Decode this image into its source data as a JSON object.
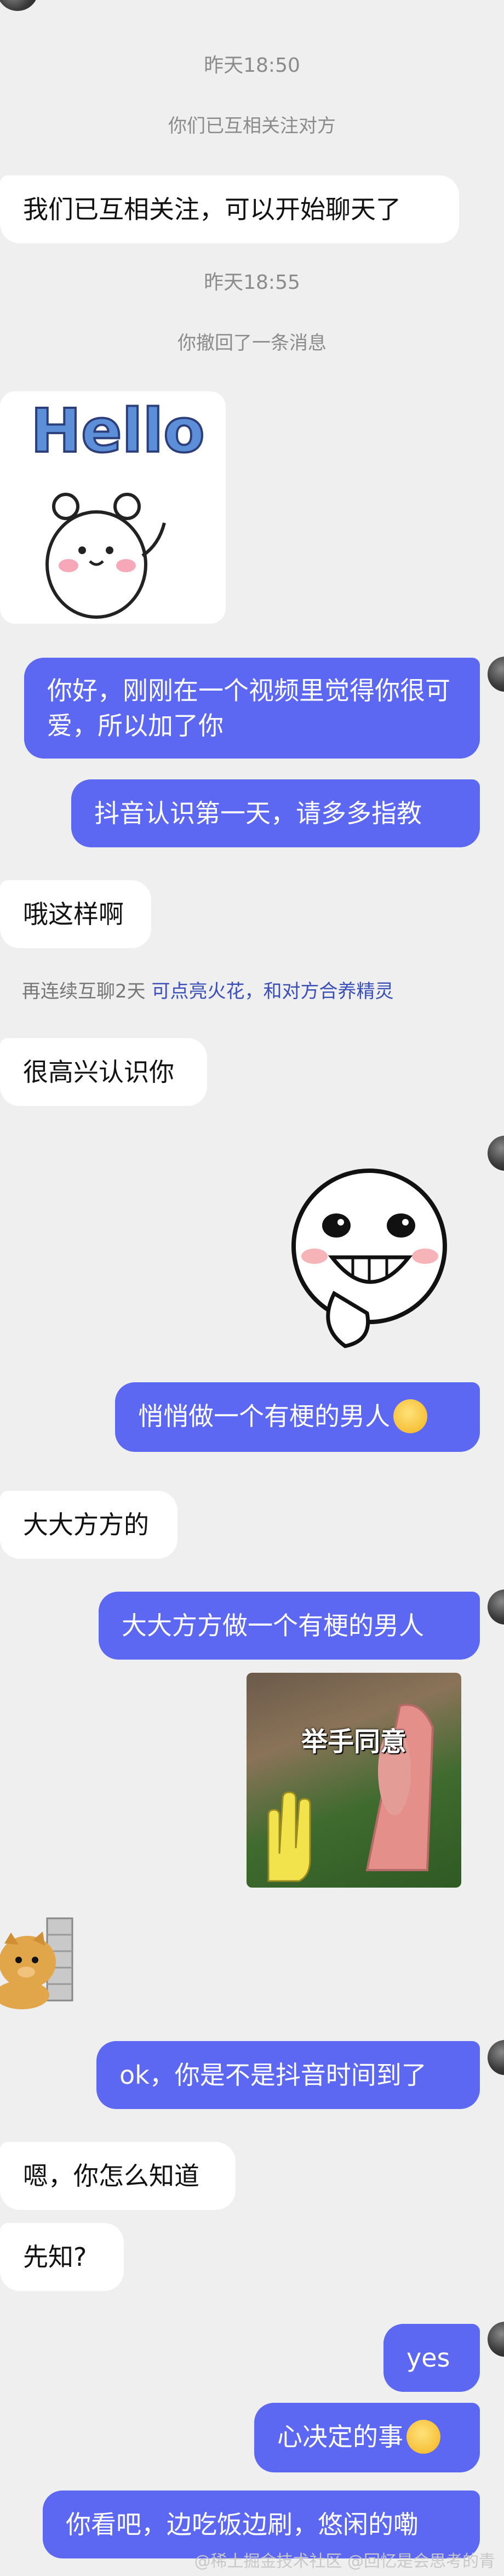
{
  "timestamps": [
    "昨天18:50",
    "昨天18:55"
  ],
  "system": {
    "followed": "你们已互相关注对方",
    "recalled": "你撤回了一条消息"
  },
  "messages": [
    {
      "side": "left",
      "text": "我们已互相关注，可以开始聊天了"
    },
    {
      "side": "right",
      "text": "你好，刚刚在一个视频里觉得你很可爱，所以加了你"
    },
    {
      "side": "right",
      "text": "抖音认识第一天，请多多指教"
    },
    {
      "side": "left",
      "text": "哦这样啊"
    },
    {
      "side": "left",
      "text": "很高兴认识你"
    },
    {
      "side": "right",
      "text": "悄悄做一个有梗的男人"
    },
    {
      "side": "left",
      "text": "大大方方的"
    },
    {
      "side": "right",
      "text": "大大方方做一个有梗的男人"
    },
    {
      "side": "right",
      "text": "ok，你是不是抖音时间到了"
    },
    {
      "side": "left",
      "text": "嗯，你怎么知道"
    },
    {
      "side": "left",
      "text": "先知?"
    },
    {
      "side": "right",
      "text": "yes"
    },
    {
      "side": "right",
      "text": "心决定的事"
    },
    {
      "side": "right",
      "text": "你看吧，边吃饭边刷，悠闲的嘞"
    }
  ],
  "spark_notice": {
    "prefix": "再连续互聊2天",
    "link": "可点亮火花，和对方合养精灵"
  },
  "stickers": {
    "hello": {
      "text": "Hello",
      "icon": "hello-bear-sticker"
    },
    "grin": {
      "icon": "grinning-face-sticker"
    },
    "meme": {
      "caption": "举手同意",
      "icon": "raise-hand-meme-sticker"
    },
    "cat": {
      "icon": "cat-peeking-sticker"
    }
  },
  "colors": {
    "accent": "#5c67f2",
    "background": "#efefef",
    "bubble_left": "#ffffff"
  },
  "watermark": "@稀土掘金技术社区 @回忆是会思考的青"
}
